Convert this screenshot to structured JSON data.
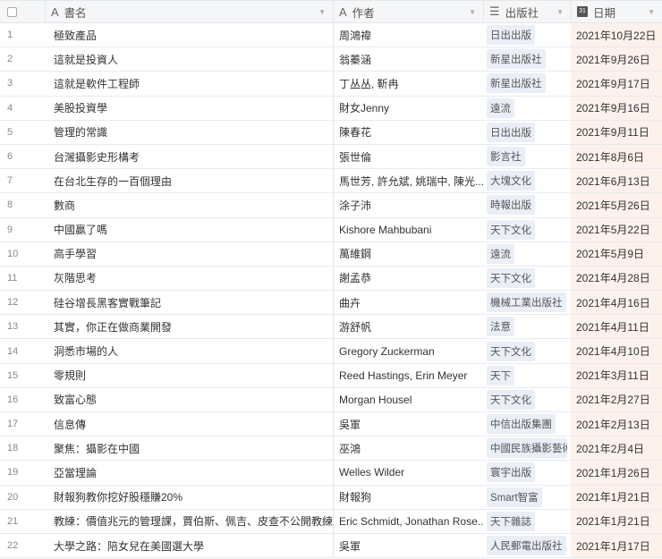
{
  "headers": {
    "title": "書名",
    "author": "作者",
    "publisher": "出版社",
    "date": "日期"
  },
  "colors": {
    "date_bg": "#fdf1ec",
    "tag_bg": "#eaeef6"
  },
  "rows": [
    {
      "n": "1",
      "title": "極致產品",
      "author": "周鴻禕",
      "publisher": "日出出版",
      "date": "2021年10月22日"
    },
    {
      "n": "2",
      "title": "這就是投資人",
      "author": "翁蓁涵",
      "publisher": "新星出版社",
      "date": "2021年9月26日"
    },
    {
      "n": "3",
      "title": "這就是軟件工程師",
      "author": "丁丛丛, 靳冉",
      "publisher": "新星出版社",
      "date": "2021年9月17日"
    },
    {
      "n": "4",
      "title": "美股投資學",
      "author": "財女Jenny",
      "publisher": "遠流",
      "date": "2021年9月16日"
    },
    {
      "n": "5",
      "title": "管理的常識",
      "author": "陳春花",
      "publisher": "日出出版",
      "date": "2021年9月11日"
    },
    {
      "n": "6",
      "title": "台灣攝影史形構考",
      "author": "張世倫",
      "publisher": "影言社",
      "date": "2021年8月6日"
    },
    {
      "n": "7",
      "title": "在台北生存的一百個理由",
      "author": "馬世芳, 許允斌, 姚瑞中, 陳光...",
      "publisher": "大塊文化",
      "date": "2021年6月13日"
    },
    {
      "n": "8",
      "title": "數商",
      "author": "涂子沛",
      "publisher": "時報出版",
      "date": "2021年5月26日"
    },
    {
      "n": "9",
      "title": "中國贏了嗎",
      "author": "Kishore Mahbubani",
      "publisher": "天下文化",
      "date": "2021年5月22日"
    },
    {
      "n": "10",
      "title": "高手學習",
      "author": "萬維鋼",
      "publisher": "遠流",
      "date": "2021年5月9日"
    },
    {
      "n": "11",
      "title": "灰階思考",
      "author": "謝孟恭",
      "publisher": "天下文化",
      "date": "2021年4月28日"
    },
    {
      "n": "12",
      "title": "硅谷增長黑客實戰筆記",
      "author": "曲卉",
      "publisher": "機械工業出版社",
      "date": "2021年4月16日"
    },
    {
      "n": "13",
      "title": "其實，你正在做商業開發",
      "author": "游舒帆",
      "publisher": "法意",
      "date": "2021年4月11日"
    },
    {
      "n": "14",
      "title": "洞悉市場的人",
      "author": "Gregory Zuckerman",
      "publisher": "天下文化",
      "date": "2021年4月10日"
    },
    {
      "n": "15",
      "title": "零規則",
      "author": "Reed Hastings, Erin Meyer",
      "publisher": "天下",
      "date": "2021年3月11日"
    },
    {
      "n": "16",
      "title": "致富心態",
      "author": "Morgan Housel",
      "publisher": "天下文化",
      "date": "2021年2月27日"
    },
    {
      "n": "17",
      "title": "信息傳",
      "author": "吳軍",
      "publisher": "中信出版集團",
      "date": "2021年2月13日"
    },
    {
      "n": "18",
      "title": "聚焦：攝影在中國",
      "author": "巫鴻",
      "publisher": "中國民族攝影藝術",
      "date": "2021年2月4日"
    },
    {
      "n": "19",
      "title": "亞當理論",
      "author": "Welles Wilder",
      "publisher": "寰宇出版",
      "date": "2021年1月26日"
    },
    {
      "n": "20",
      "title": "財報狗教你挖好股穩賺20%",
      "author": "財報狗",
      "publisher": "Smart智富",
      "date": "2021年1月21日"
    },
    {
      "n": "21",
      "title": "教練：價值兆元的管理課，賈伯斯、佩吉、皮查不公開教練的...",
      "author": "Eric Schmidt, Jonathan Rose...",
      "publisher": "天下雜誌",
      "date": "2021年1月21日"
    },
    {
      "n": "22",
      "title": "大學之路：陪女兒在美國選大學",
      "author": "吳軍",
      "publisher": "人民郵電出版社",
      "date": "2021年1月17日"
    }
  ]
}
